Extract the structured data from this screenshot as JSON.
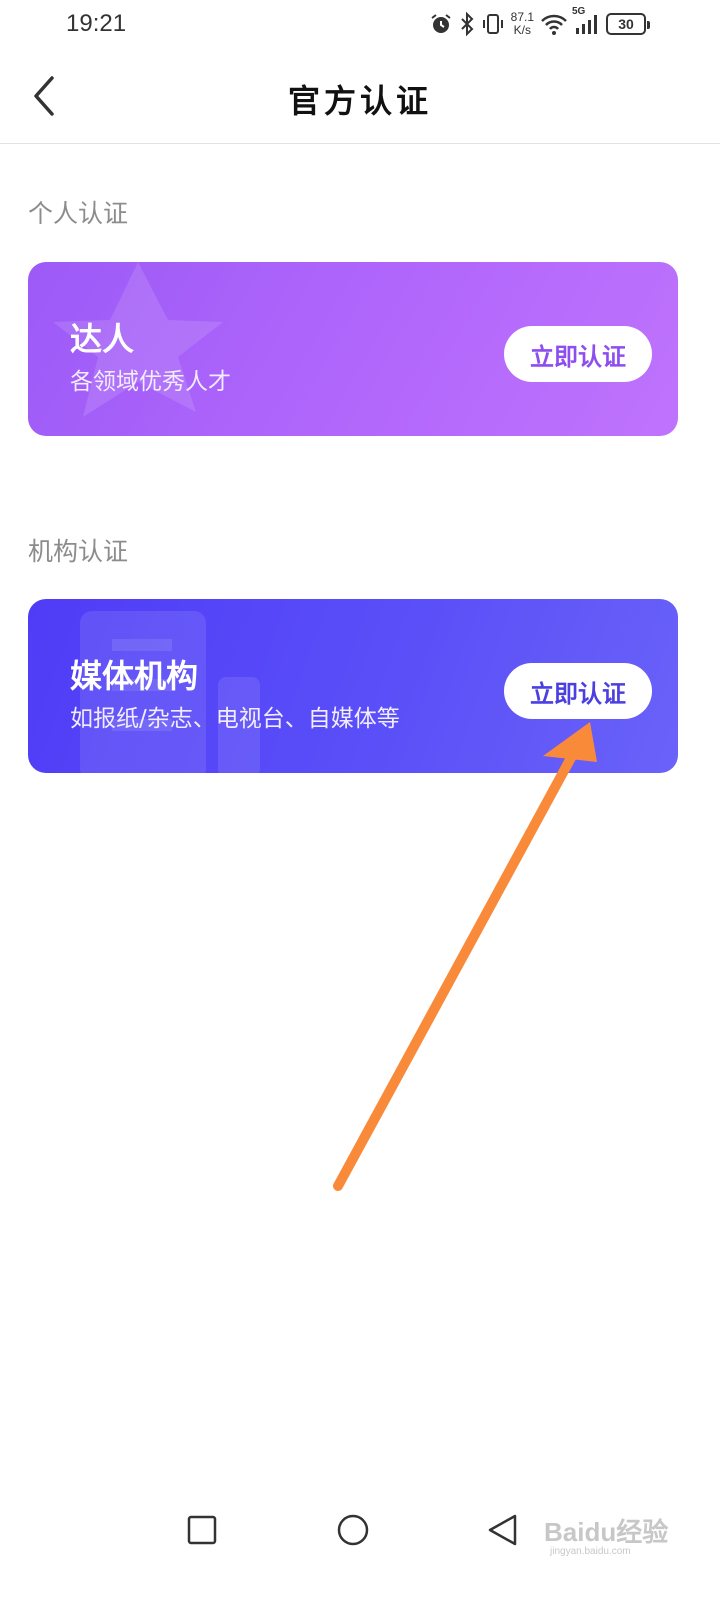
{
  "status_bar": {
    "time": "19:21",
    "net_speed_value": "87.1",
    "net_speed_unit": "K/s",
    "signal_label": "5G",
    "battery_level": "30",
    "icons": [
      "alarm-icon",
      "bluetooth-icon",
      "vibrate-icon",
      "wifi-icon",
      "signal-icon",
      "battery-icon"
    ]
  },
  "header": {
    "title": "官方认证",
    "back_icon": "chevron-left-icon"
  },
  "sections": {
    "personal": {
      "label": "个人认证",
      "card": {
        "title": "达人",
        "description": "各领域优秀人才",
        "button": "立即认证",
        "deco_icon": "star-icon"
      }
    },
    "organization": {
      "label": "机构认证",
      "card": {
        "title": "媒体机构",
        "description": "如报纸/杂志、电视台、自媒体等",
        "button": "立即认证",
        "deco_icon": "building-icon"
      }
    }
  },
  "annotation": {
    "arrow_color": "#f98a3a"
  },
  "nav_bar": {
    "icons": [
      "recent-apps-icon",
      "home-icon",
      "back-icon"
    ]
  },
  "watermark": {
    "logo": "Baidu经验",
    "url": "jingyan.baidu.com"
  },
  "colors": {
    "personal_card": "#b066fb",
    "media_card": "#5a4ff8",
    "section_label": "#8c8c8c"
  }
}
